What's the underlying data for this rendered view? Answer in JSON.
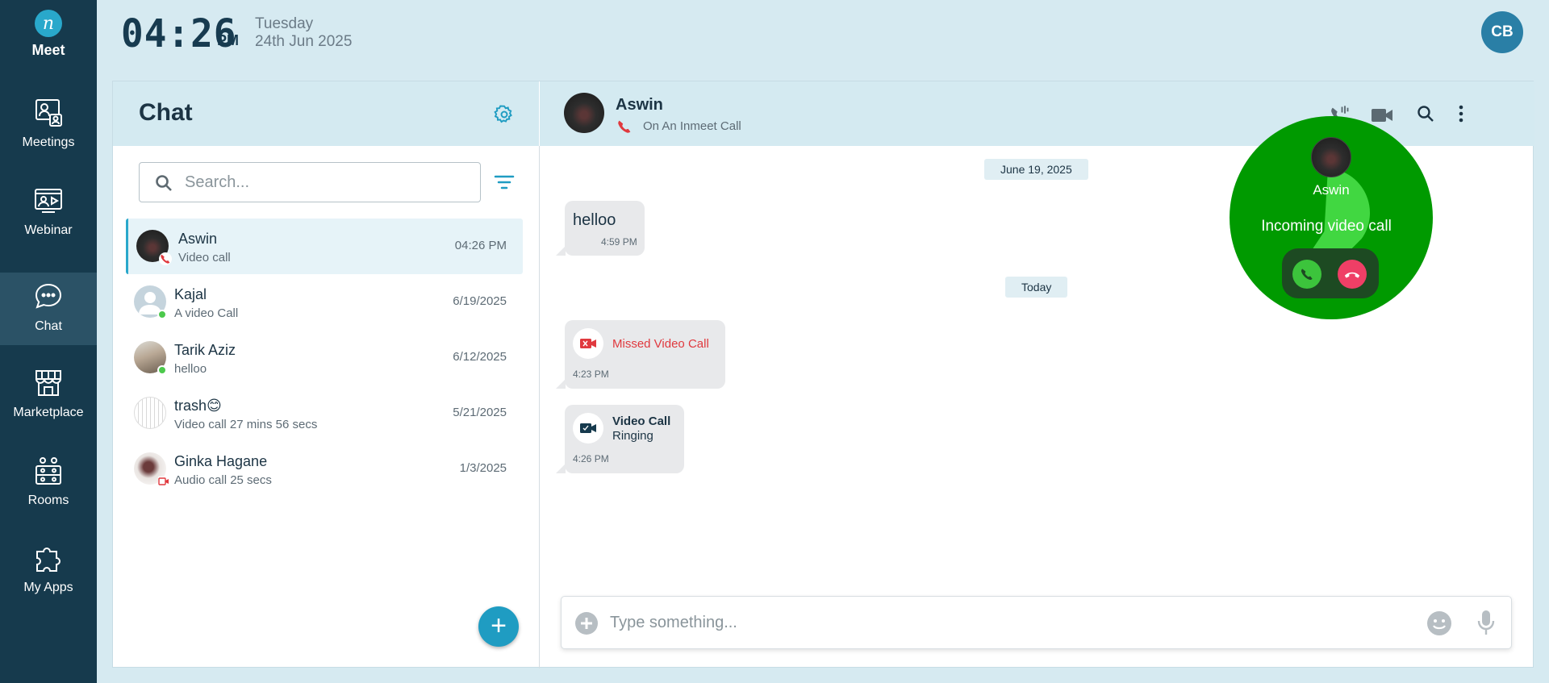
{
  "brand": {
    "name": "Meet",
    "logo_letter": "n"
  },
  "nav": [
    {
      "label": "Meetings",
      "icon": "meetings-icon"
    },
    {
      "label": "Webinar",
      "icon": "webinar-icon"
    },
    {
      "label": "Chat",
      "icon": "chat-icon",
      "active": true
    },
    {
      "label": "Marketplace",
      "icon": "marketplace-icon"
    },
    {
      "label": "Rooms",
      "icon": "rooms-icon"
    },
    {
      "label": "My Apps",
      "icon": "puzzle-icon"
    }
  ],
  "topbar": {
    "time": "04:26",
    "ampm": "PM",
    "day": "Tuesday",
    "date": "24th Jun 2025",
    "user_initials": "CB"
  },
  "chat_panel": {
    "title": "Chat",
    "search_placeholder": "Search...",
    "items": [
      {
        "name": "Aswin",
        "preview": "Video call",
        "time": "04:26 PM"
      },
      {
        "name": "Kajal",
        "preview": "A video Call",
        "time": "6/19/2025"
      },
      {
        "name": "Tarik Aziz",
        "preview": "helloo",
        "time": "6/12/2025"
      },
      {
        "name": "trash😊",
        "preview": "Video call 27 mins 56 secs",
        "time": "5/21/2025"
      },
      {
        "name": "Ginka Hagane",
        "preview": "Audio call 25 secs",
        "time": "1/3/2025"
      }
    ],
    "fab_label": "+"
  },
  "conversation": {
    "contact_name": "Aswin",
    "contact_status": "On An Inmeet Call",
    "date_separators": [
      "June 19, 2025",
      "Today"
    ],
    "messages": [
      {
        "text": "helloo",
        "time": "4:59 PM"
      },
      {
        "title": "Missed Video Call",
        "time": "4:23 PM"
      },
      {
        "title": "Video Call",
        "subtitle": "Ringing",
        "time": "4:26 PM"
      }
    ],
    "composer_placeholder": "Type something..."
  },
  "incoming_call": {
    "name": "Aswin",
    "text": "Incoming video call"
  },
  "colors": {
    "sidebar": "#163a4d",
    "accent": "#1f9cc2",
    "missed": "#e0393e",
    "call_bg": "#009a00",
    "accept": "#3cc43c",
    "decline": "#ef3f66"
  }
}
